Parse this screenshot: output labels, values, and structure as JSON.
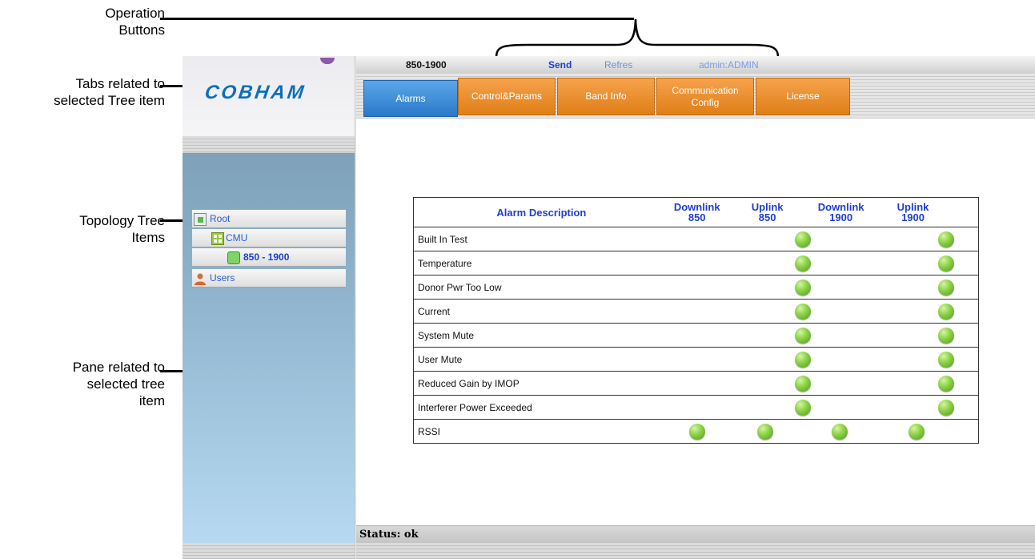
{
  "callouts": {
    "operation_buttons": [
      "Operation",
      "Buttons"
    ],
    "tabs": [
      "Tabs related to",
      "selected Tree item"
    ],
    "tree": [
      "Topology Tree",
      "Items"
    ],
    "pane": [
      "Pane related to",
      "selected tree",
      "item"
    ]
  },
  "logo": "COBHAM",
  "opbar": {
    "device": "850-1900",
    "send": "Send",
    "refresh": "Refres",
    "user": "admin:ADMIN"
  },
  "tabs": [
    {
      "label": "Alarms",
      "active": true
    },
    {
      "label": "Control&Params",
      "active": false
    },
    {
      "label": "Band Info",
      "active": false
    },
    {
      "label": "Communication Config",
      "active": false
    },
    {
      "label": "License",
      "active": false
    }
  ],
  "tree": [
    {
      "label": "Root",
      "icon": "root-icon"
    },
    {
      "label": "CMU",
      "icon": "cmu-icon"
    },
    {
      "label": "850 - 1900",
      "icon": "device-icon"
    },
    {
      "label": "Users",
      "icon": "users-icon"
    }
  ],
  "table": {
    "headers": [
      "Alarm Description",
      "Downlink 850",
      "Uplink 850",
      "Downlink 1900",
      "Uplink 1900"
    ],
    "rows": [
      {
        "desc": "Built In Test",
        "leds": [
          false,
          true,
          false,
          true
        ]
      },
      {
        "desc": "Temperature",
        "leds": [
          false,
          true,
          false,
          true
        ]
      },
      {
        "desc": "Donor Pwr Too Low",
        "leds": [
          false,
          true,
          false,
          true
        ]
      },
      {
        "desc": "Current",
        "leds": [
          false,
          true,
          false,
          true
        ]
      },
      {
        "desc": "System Mute",
        "leds": [
          false,
          true,
          false,
          true
        ]
      },
      {
        "desc": "User Mute",
        "leds": [
          false,
          true,
          false,
          true
        ]
      },
      {
        "desc": "Reduced Gain by IMOP",
        "leds": [
          false,
          true,
          false,
          true
        ]
      },
      {
        "desc": "Interferer Power Exceeded",
        "leds": [
          false,
          true,
          false,
          true
        ]
      },
      {
        "desc": "RSSI",
        "leds": [
          true,
          true,
          true,
          true
        ]
      }
    ]
  },
  "status": "Status: ok",
  "colors": {
    "led": "#6cbf2e",
    "tab_orange": "#ee8f2c",
    "tab_active": "#3a8ad8",
    "link_blue": "#1f3ecf"
  }
}
